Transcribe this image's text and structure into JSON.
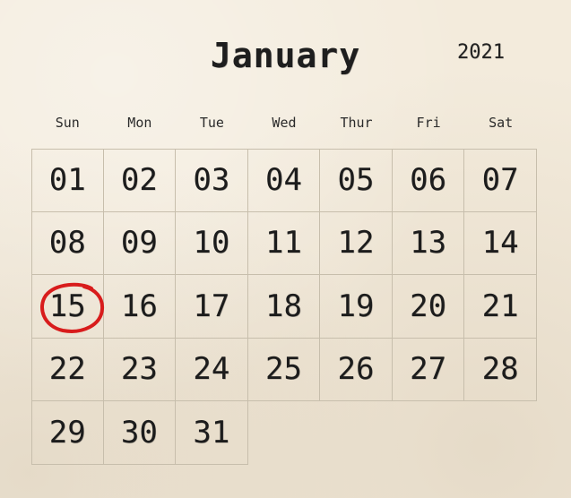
{
  "calendar": {
    "month": "January",
    "year": "2021",
    "weekdays": [
      "Sun",
      "Mon",
      "Tue",
      "Wed",
      "Thur",
      "Fri",
      "Sat"
    ],
    "days": [
      "01",
      "02",
      "03",
      "04",
      "05",
      "06",
      "07",
      "08",
      "09",
      "10",
      "11",
      "12",
      "13",
      "14",
      "15",
      "16",
      "17",
      "18",
      "19",
      "20",
      "21",
      "22",
      "23",
      "24",
      "25",
      "26",
      "27",
      "28",
      "29",
      "30",
      "31"
    ],
    "highlighted_day": "15",
    "highlight_color": "#d81c1c"
  }
}
